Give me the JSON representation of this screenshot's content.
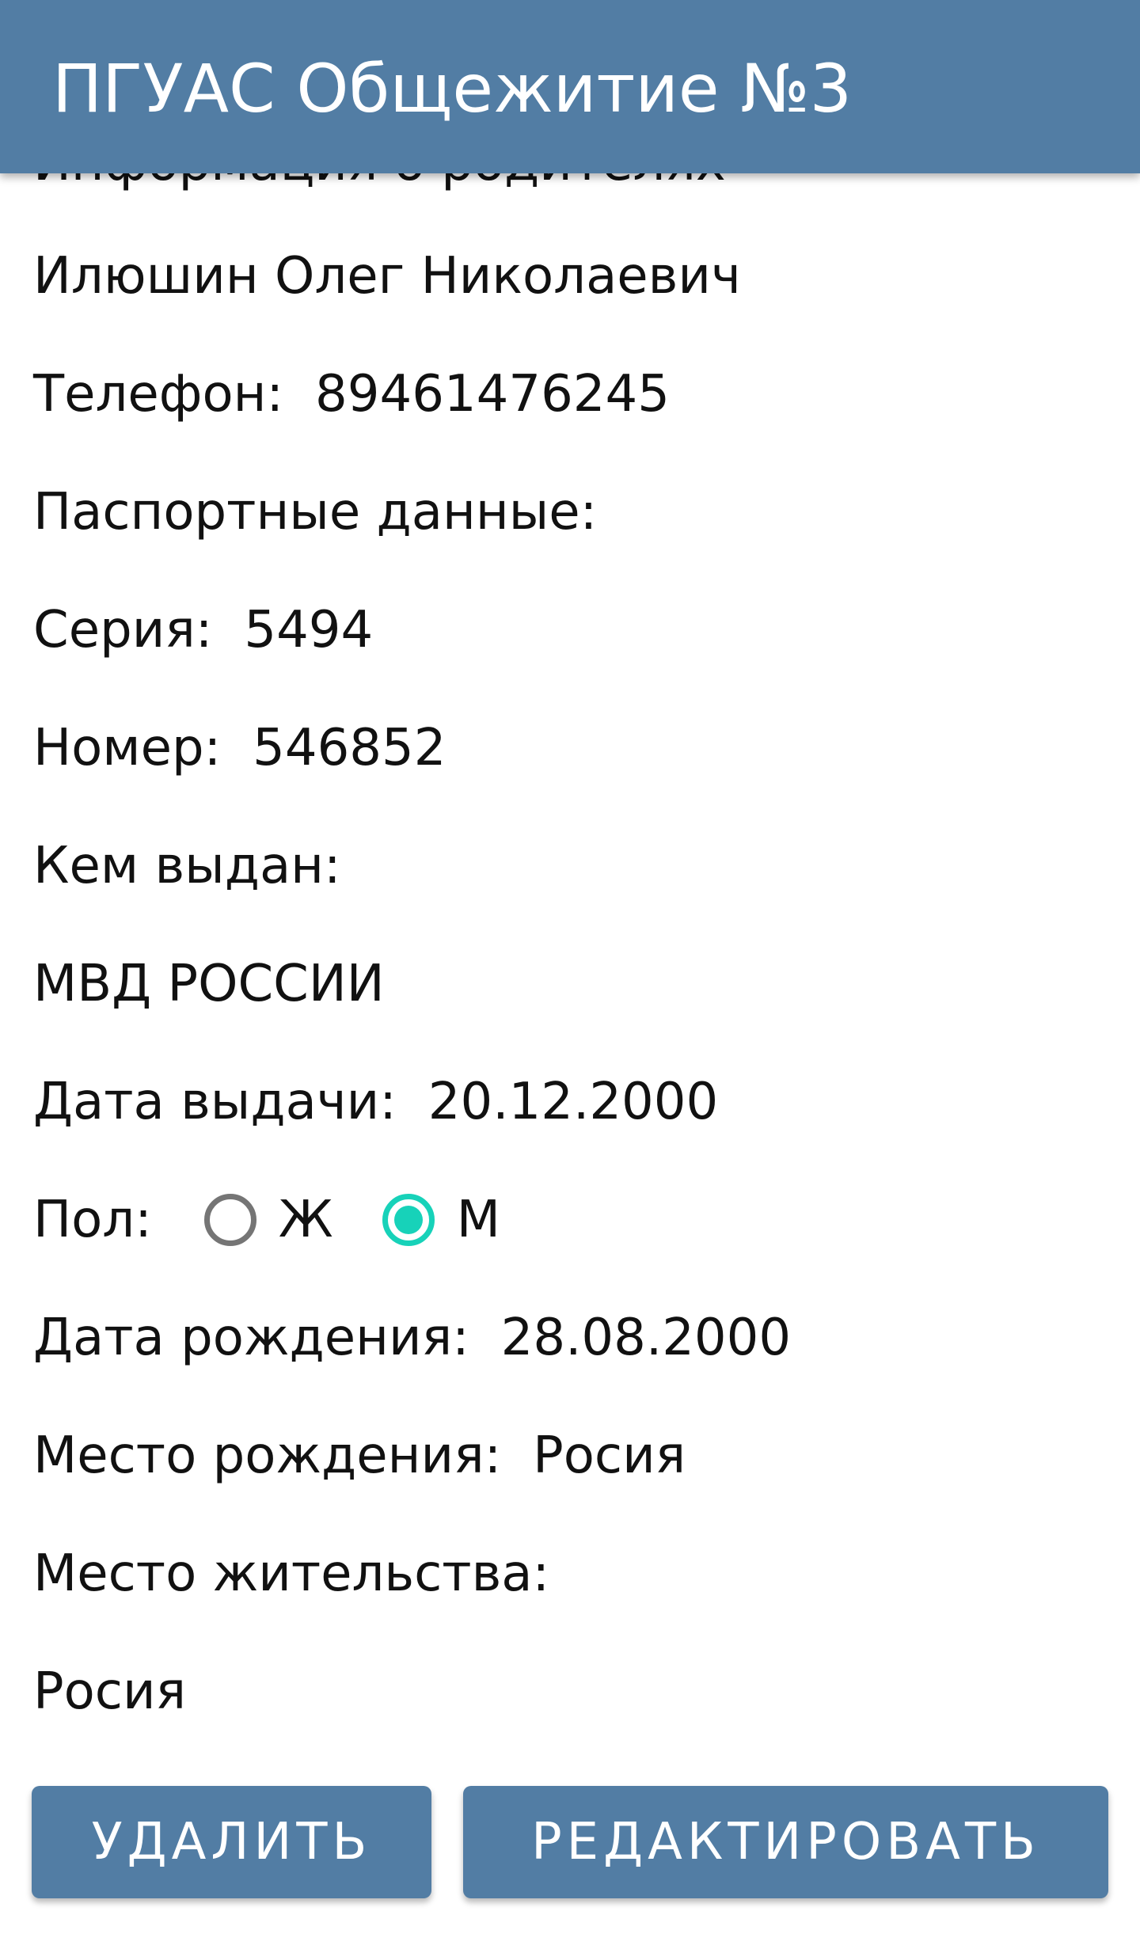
{
  "app_bar": {
    "title": "ПГУАС Общежитие №3"
  },
  "details": {
    "parent_section_title": "Информация о родителях",
    "parent_name": "Илюшин Олег Николаевич",
    "phone_label": "Телефон:",
    "phone_value": "89461476245",
    "passport_header": "Паспортные данные:",
    "series_label": "Серия:",
    "series_value": "5494",
    "number_label": "Номер:",
    "number_value": "546852",
    "issued_by_label": "Кем выдан:",
    "issued_by_value": "МВД РОССИИ",
    "issue_date_label": "Дата выдачи:",
    "issue_date_value": "20.12.2000",
    "gender_label": "Пол:",
    "gender_options": [
      {
        "label": "Ж",
        "checked": false
      },
      {
        "label": "М",
        "checked": true
      }
    ],
    "birth_date_label": "Дата рождения:",
    "birth_date_value": "28.08.2000",
    "birth_place_label": "Место рождения:",
    "birth_place_value": "Росия",
    "residence_label": "Место жительства:",
    "residence_value": "Росия"
  },
  "actions": {
    "delete_label": "УДАЛИТЬ",
    "edit_label": "РЕДАКТИРОВАТЬ"
  },
  "colors": {
    "app_bar": "#527da4",
    "button": "#527da4",
    "radio_accent": "#17d2b9",
    "radio_unchecked": "#757575"
  }
}
